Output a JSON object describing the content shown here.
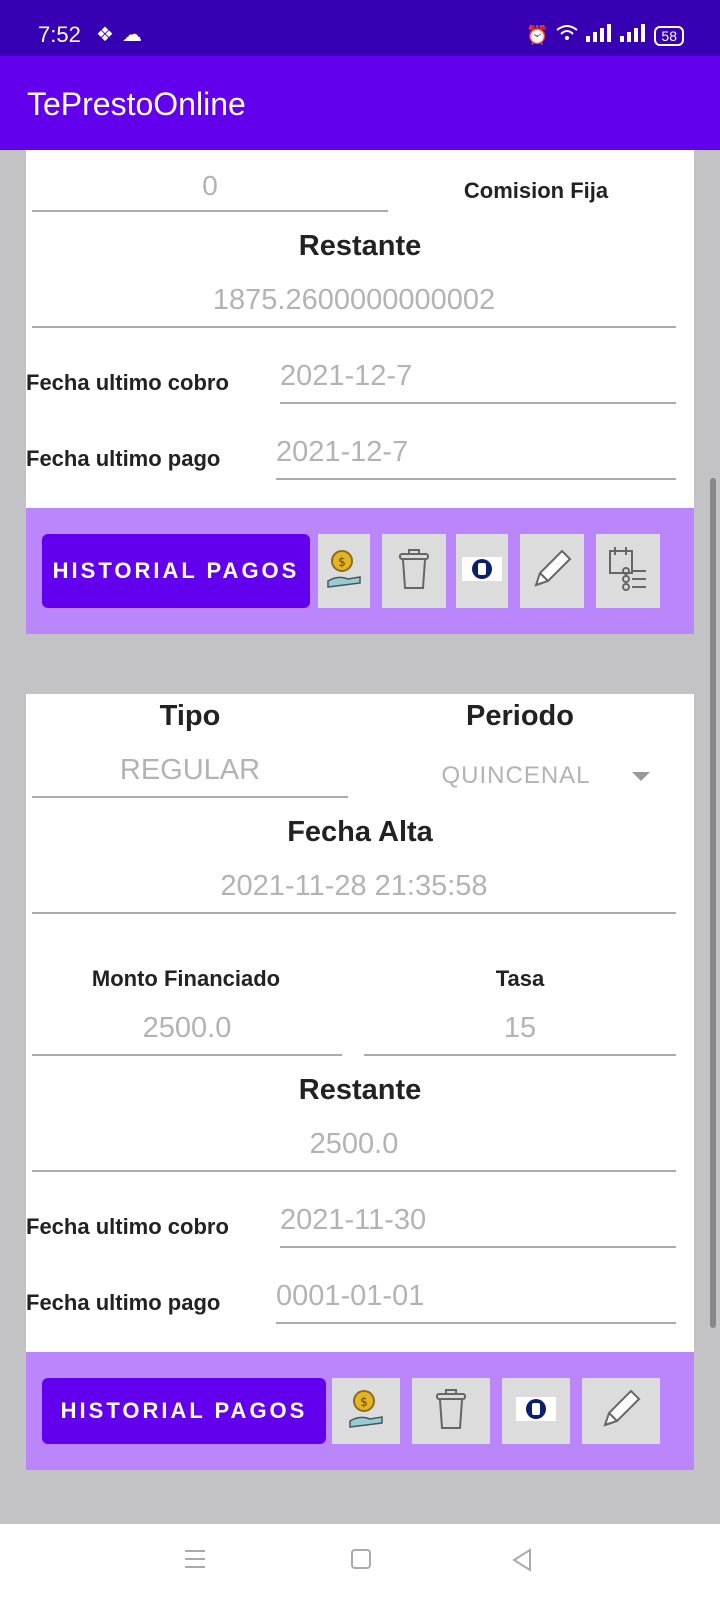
{
  "status_bar": {
    "time": "7:52",
    "battery": "58"
  },
  "app": {
    "title": "TePrestoOnline"
  },
  "card1": {
    "commission_value": "0",
    "commission_label": "Comision Fija",
    "remaining_label": "Restante",
    "remaining_value": "1875.2600000000002",
    "last_charge_label": "Fecha ultimo cobro",
    "last_charge_value": "2021-12-7",
    "last_payment_label": "Fecha ultimo pago",
    "last_payment_value": "2021-12-7",
    "history_button": "HISTORIAL PAGOS"
  },
  "card2": {
    "type_label": "Tipo",
    "type_value": "REGULAR",
    "period_label": "Periodo",
    "period_value": "QUINCENAL",
    "date_label": "Fecha Alta",
    "date_value": "2021-11-28 21:35:58",
    "amount_label": "Monto Financiado",
    "amount_value": "2500.0",
    "rate_label": "Tasa",
    "rate_value": "15",
    "remaining_label": "Restante",
    "remaining_value": "2500.0",
    "last_charge_label": "Fecha ultimo cobro",
    "last_charge_value": "2021-11-30",
    "last_payment_label": "Fecha ultimo pago",
    "last_payment_value": "0001-01-01",
    "history_button": "HISTORIAL PAGOS"
  },
  "icons": [
    "payment-icon",
    "trash-icon",
    "record-icon",
    "pencil-icon",
    "schedule-list-icon"
  ],
  "colors": {
    "status_bar": "#3700b3",
    "app_bar": "#6200ee",
    "action_bar": "#bb86fc",
    "primary_button": "#6200ee"
  }
}
